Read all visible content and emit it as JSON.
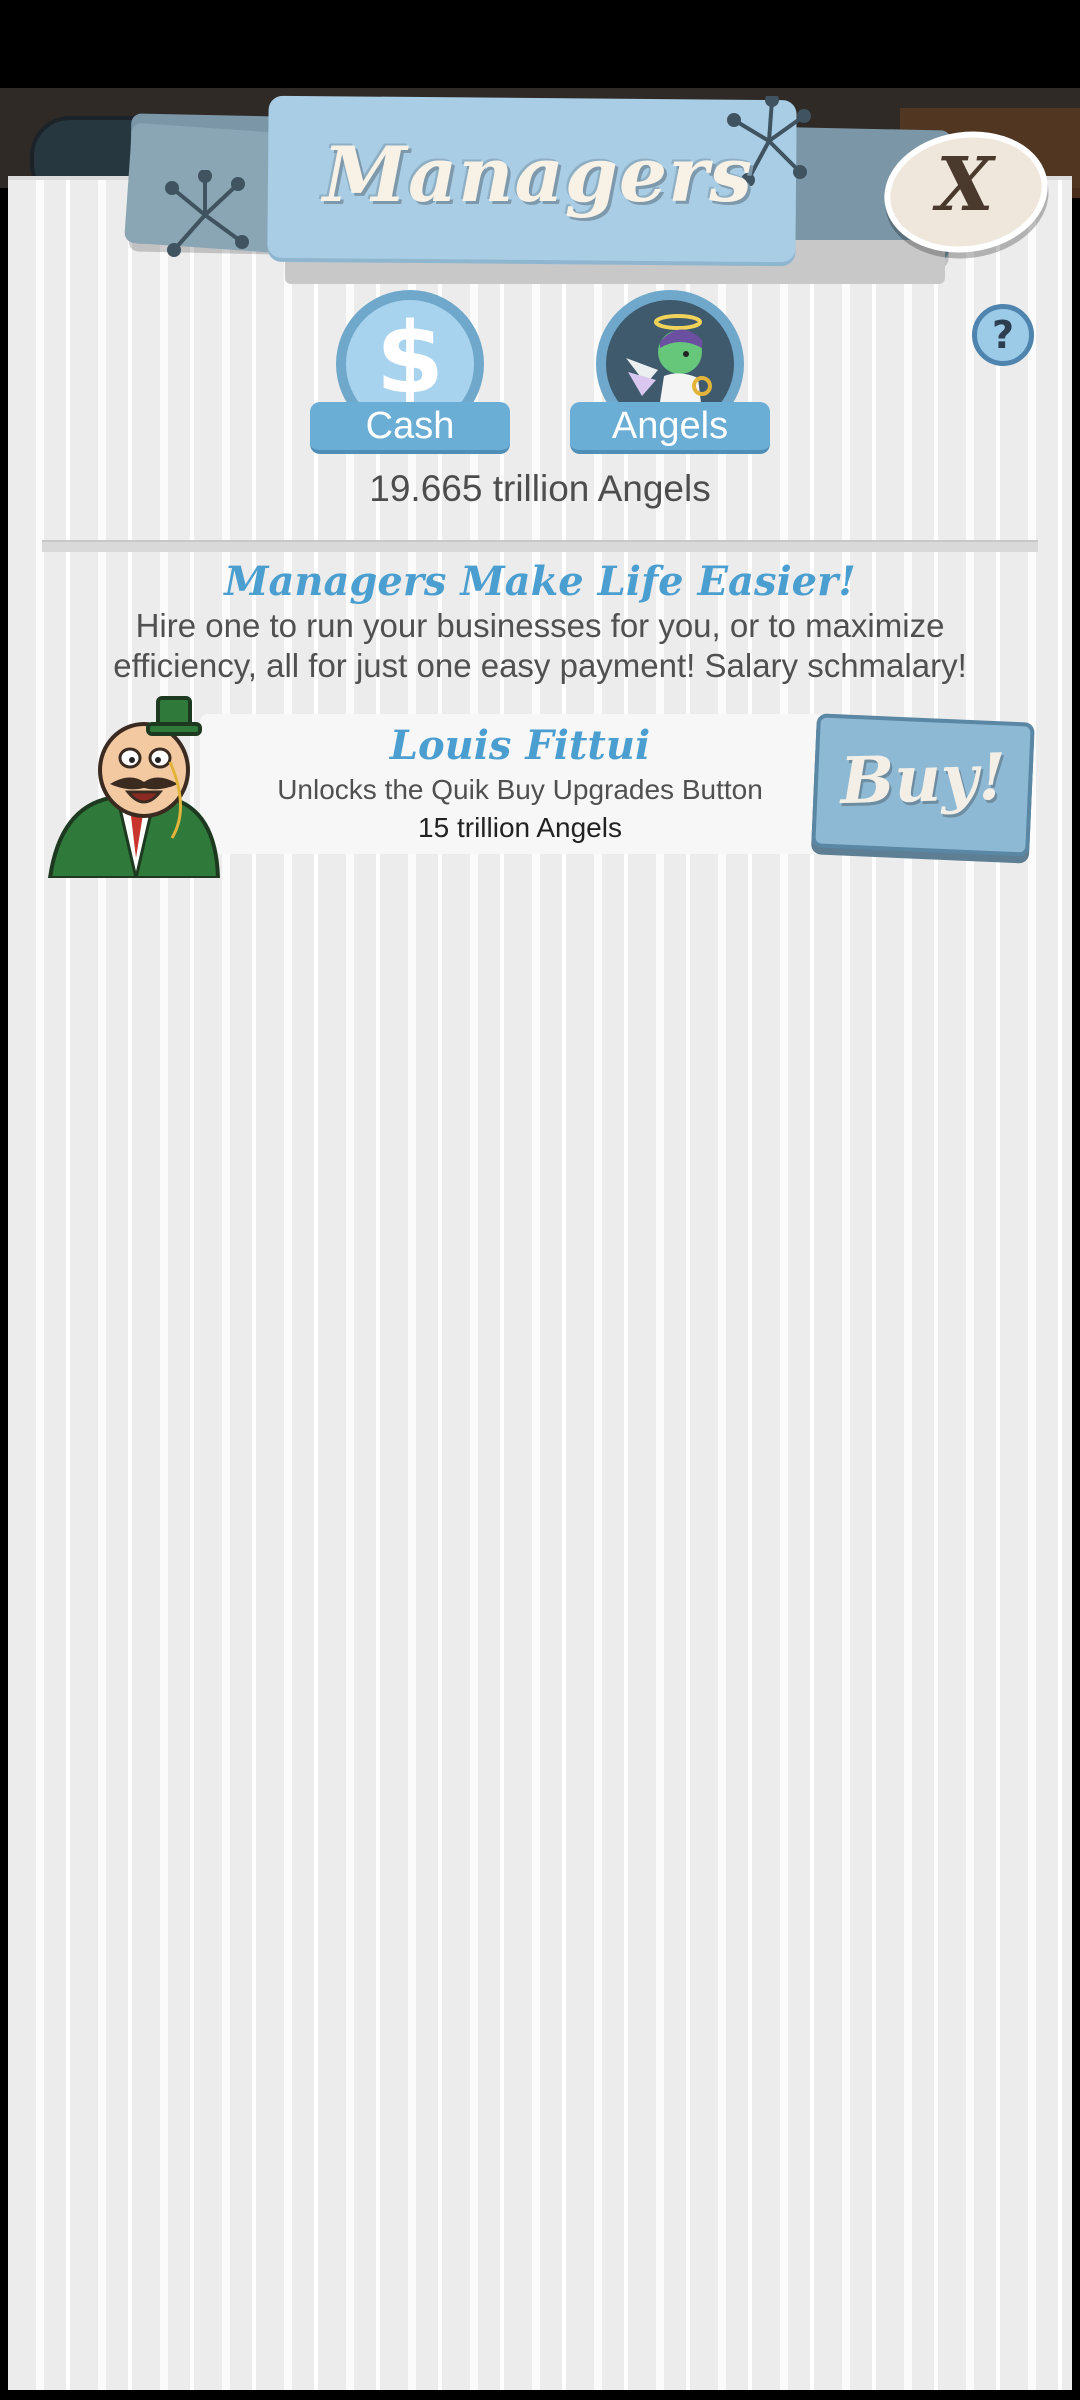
{
  "header": {
    "title": "Managers",
    "close_label": "X",
    "help_label": "?"
  },
  "currency_tabs": [
    {
      "label": "Cash",
      "icon": "dollar-icon",
      "symbol": "$"
    },
    {
      "label": "Angels",
      "icon": "angel-icon"
    }
  ],
  "balance": "19.665 trillion Angels",
  "section": {
    "title": "Managers Make Life Easier!",
    "description": "Hire one to run your businesses for you, or to maximize efficiency, all for just one easy payment! Salary schmalary!"
  },
  "managers": [
    {
      "name": "Louis Fittui",
      "description": "Unlocks the Quik Buy Upgrades Button",
      "cost": "15 trillion Angels",
      "buy_label": "Buy!"
    }
  ],
  "colors": {
    "accent_blue": "#4b9fd0",
    "banner_blue": "#a9cde4",
    "panel_bg": "#ececec"
  }
}
